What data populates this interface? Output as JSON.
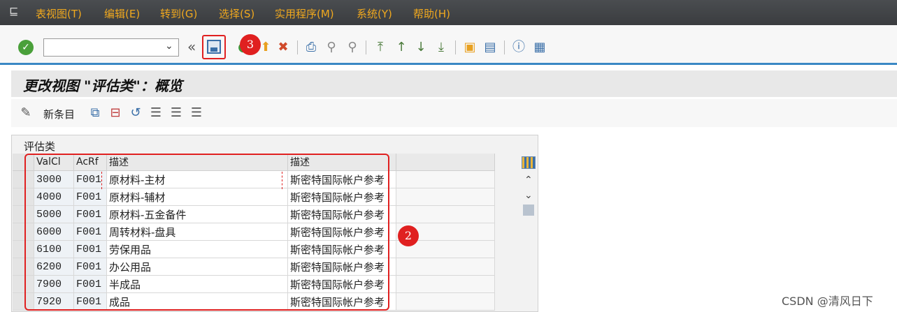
{
  "menu": [
    "表视图(T)",
    "编辑(E)",
    "转到(G)",
    "选择(S)",
    "实用程序(M)",
    "系统(Y)",
    "帮助(H)"
  ],
  "toolbar": {
    "command_value": "",
    "badge_3": "3"
  },
  "page_title": "更改视图 \"评估类\"：概览",
  "app_toolbar": {
    "new_entries": "新条目"
  },
  "panel_title": "评估类",
  "table": {
    "headers": [
      "ValCl",
      "AcRf",
      "描述",
      "描述"
    ],
    "rows": [
      [
        "3000",
        "F001",
        "原材料-主材",
        "斯密特国际帐户参考"
      ],
      [
        "4000",
        "F001",
        "原材料-辅材",
        "斯密特国际帐户参考"
      ],
      [
        "5000",
        "F001",
        "原材料-五金备件",
        "斯密特国际帐户参考"
      ],
      [
        "6000",
        "F001",
        "周转材料-盘具",
        "斯密特国际帐户参考"
      ],
      [
        "6100",
        "F001",
        "劳保用品",
        "斯密特国际帐户参考"
      ],
      [
        "6200",
        "F001",
        "办公用品",
        "斯密特国际帐户参考"
      ],
      [
        "7900",
        "F001",
        "半成品",
        "斯密特国际帐户参考"
      ],
      [
        "7920",
        "F001",
        "成品",
        "斯密特国际帐户参考"
      ]
    ]
  },
  "badge_2": "2",
  "watermark": "CSDN @清风日下"
}
